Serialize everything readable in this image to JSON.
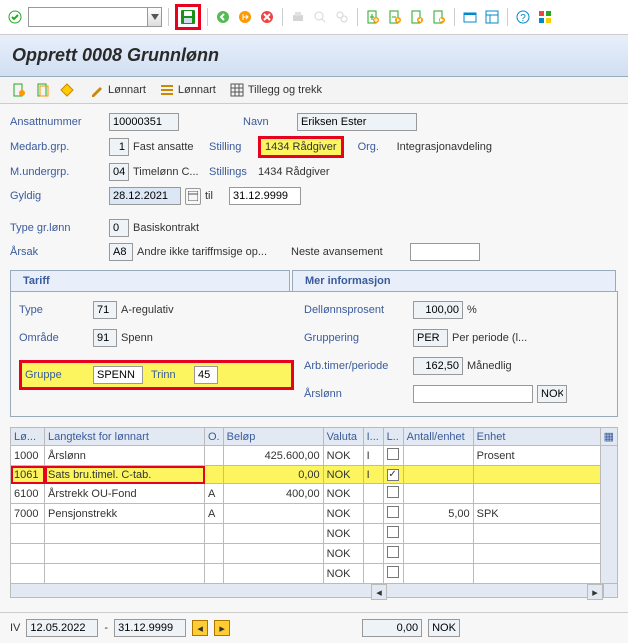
{
  "header": {
    "title": "Opprett 0008 Grunnlønn"
  },
  "buttonrow": {
    "lonnart1": "Lønnart",
    "lonnart2": "Lønnart",
    "tillegg": "Tillegg og trekk"
  },
  "fields": {
    "ansattnr_lbl": "Ansattnummer",
    "ansattnr": "10000351",
    "navn_lbl": "Navn",
    "navn": "Eriksen Ester",
    "medarb_lbl": "Medarb.grp.",
    "medarb": "1",
    "medarb_txt": "Fast ansatte",
    "stilling_lbl": "Stilling",
    "stilling": "1434 Rådgiver",
    "org_lbl": "Org.",
    "org_txt": "Integrasjonavdeling",
    "munder_lbl": "M.undergrp.",
    "munder": "04",
    "munder_txt": "Timelønn C...",
    "stillings_lbl": "Stillings",
    "stillings": "1434 Rådgiver",
    "gyldig_lbl": "Gyldig",
    "gyldig_fra": "28.12.2021",
    "til_lbl": "til",
    "gyldig_til": "31.12.9999",
    "typegr_lbl": "Type gr.lønn",
    "typegr": "0",
    "typegr_txt": "Basiskontrakt",
    "arsak_lbl": "Årsak",
    "arsak": "A8",
    "arsak_txt": "Andre ikke tariffmsige op...",
    "arsak_txt2": "Neste avansement"
  },
  "tabs": {
    "tariff": "Tariff",
    "mer": "Mer informasjon"
  },
  "tariff": {
    "type_lbl": "Type",
    "type": "71",
    "type_txt": "A-regulativ",
    "omrade_lbl": "Område",
    "omrade": "91",
    "omrade_txt": "Spenn",
    "gruppe_lbl": "Gruppe",
    "gruppe": "SPENN",
    "trinn_lbl": "Trinn",
    "trinn": "45"
  },
  "mer": {
    "dell_lbl": "Dellønnsprosent",
    "dell": "100,00",
    "dell_sfx": "%",
    "grup_lbl": "Gruppering",
    "grup": "PER",
    "grup_txt": "Per periode (l...",
    "arb_lbl": "Arb.timer/periode",
    "arb": "162,50",
    "arb_txt": "Månedlig",
    "arsl_lbl": "Årslønn",
    "arsl": "",
    "arsl_cur": "NOK"
  },
  "gridhead": {
    "lo": "Lø...",
    "langt": "Langtekst for lønnart",
    "o": "O.",
    "belop": "Beløp",
    "valuta": "Valuta",
    "i": "I...",
    "l": "L..",
    "antall": "Antall/enhet",
    "enhet": "Enhet"
  },
  "gridrows": [
    {
      "lo": "1000",
      "txt": "Årslønn",
      "o": "",
      "belop": "425.600,00",
      "val": "NOK",
      "i": "I",
      "chk": false,
      "ant": "",
      "enh": "Prosent"
    },
    {
      "lo": "1061",
      "txt": "Sats bru.timel. C-tab.",
      "o": "",
      "belop": "0,00",
      "val": "NOK",
      "i": "I",
      "chk": true,
      "ant": "",
      "enh": "",
      "hl": true
    },
    {
      "lo": "6100",
      "txt": "Årstrekk OU-Fond",
      "o": "A",
      "belop": "400,00",
      "val": "NOK",
      "i": "",
      "chk": false,
      "ant": "",
      "enh": ""
    },
    {
      "lo": "7000",
      "txt": "Pensjonstrekk",
      "o": "A",
      "belop": "",
      "val": "NOK",
      "i": "",
      "chk": false,
      "ant": "5,00",
      "enh": "SPK"
    },
    {
      "lo": "",
      "txt": "",
      "o": "",
      "belop": "",
      "val": "NOK",
      "i": "",
      "chk": false,
      "ant": "",
      "enh": ""
    },
    {
      "lo": "",
      "txt": "",
      "o": "",
      "belop": "",
      "val": "NOK",
      "i": "",
      "chk": false,
      "ant": "",
      "enh": ""
    },
    {
      "lo": "",
      "txt": "",
      "o": "",
      "belop": "",
      "val": "NOK",
      "i": "",
      "chk": false,
      "ant": "",
      "enh": ""
    }
  ],
  "footer": {
    "iv": "IV",
    "d1": "12.05.2022",
    "sep": "-",
    "d2": "31.12.9999",
    "amt": "0,00",
    "cur": "NOK"
  }
}
